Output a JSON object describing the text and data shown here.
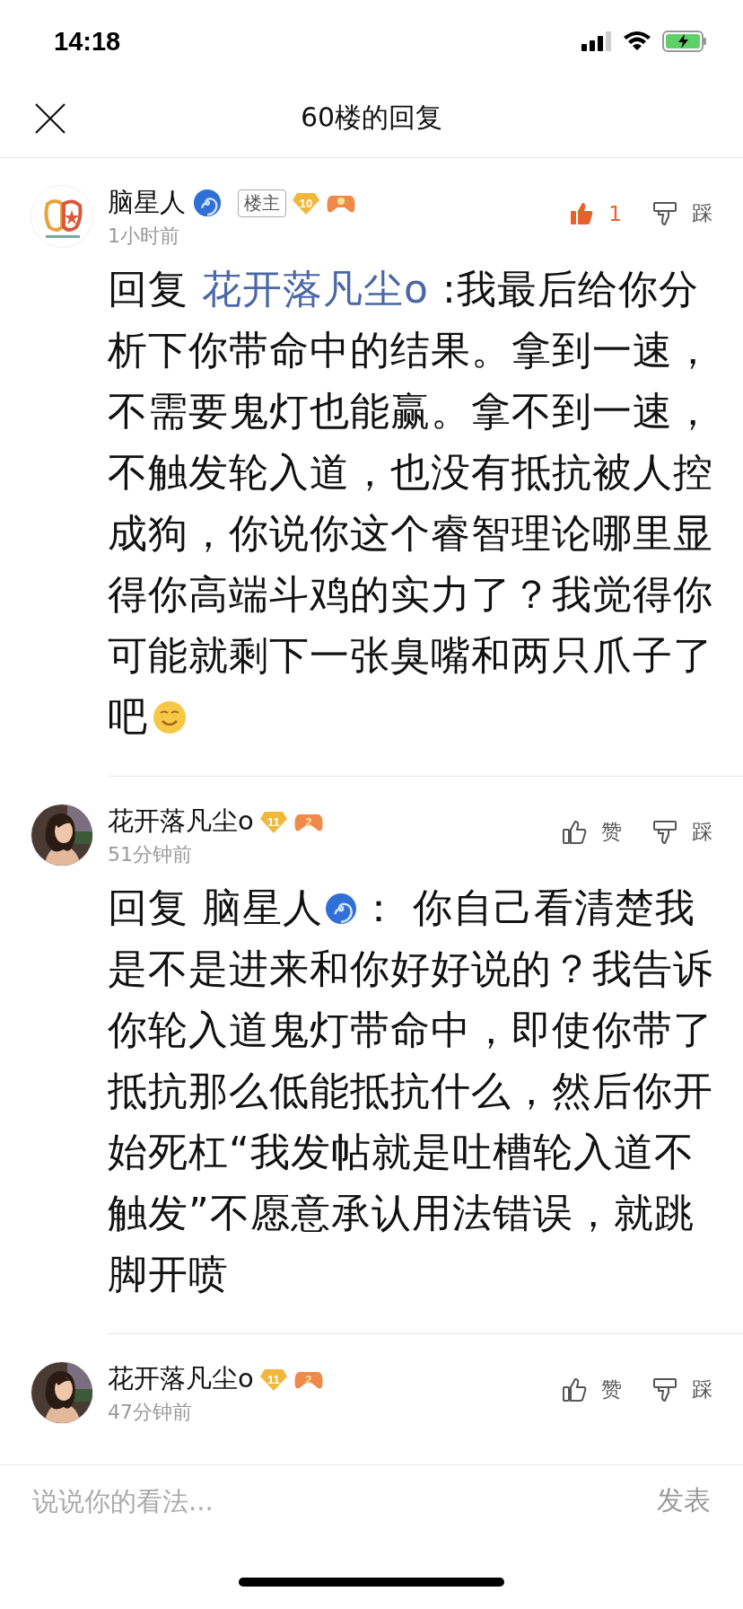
{
  "status_bar": {
    "time": "14:18"
  },
  "nav": {
    "title": "60楼的回复"
  },
  "comments": [
    {
      "kind": "logo",
      "author": "脑星人",
      "verified": true,
      "op_label": "楼主",
      "level": "10",
      "time": "1小时前",
      "like": {
        "label": "1",
        "liked": true
      },
      "dislike": {
        "label": "踩"
      },
      "body": {
        "prefix": "回复 ",
        "reply_to": "花开落凡尘o",
        "reply_to_verified": false,
        "reply_to_linked": true,
        "text": " :我最后给你分析下你带命中的结果。拿到一速，不需要鬼灯也能赢。拿不到一速，不触发轮入道，也没有抵抗被人控成狗，你说你这个睿智理论哪里显得你高端斗鸡的实力了？我觉得你可能就剩下一张臭嘴和两只爪子了吧",
        "emoji": true
      }
    },
    {
      "author": "花开落凡尘o",
      "verified": false,
      "level": "11",
      "game_badge": "2",
      "time": "51分钟前",
      "like": {
        "label": "赞",
        "liked": false
      },
      "dislike": {
        "label": "踩"
      },
      "body": {
        "prefix": "回复 ",
        "reply_to": "脑星人",
        "reply_to_verified": true,
        "reply_to_linked": false,
        "text": "： 你自己看清楚我是不是进来和你好好说的？我告诉你轮入道鬼灯带命中，即使你带了抵抗那么低能抵抗什么，然后你开始死杠“我发帖就是吐槽轮入道不触发”不愿意承认用法错误，就跳脚开喷",
        "emoji": false
      }
    },
    {
      "author": "花开落凡尘o",
      "verified": false,
      "level": "11",
      "game_badge": "2",
      "time": "47分钟前",
      "like": {
        "label": "赞",
        "liked": false
      },
      "dislike": {
        "label": "踩"
      }
    }
  ],
  "composer": {
    "placeholder": "说说你的看法...",
    "send": "发表"
  }
}
